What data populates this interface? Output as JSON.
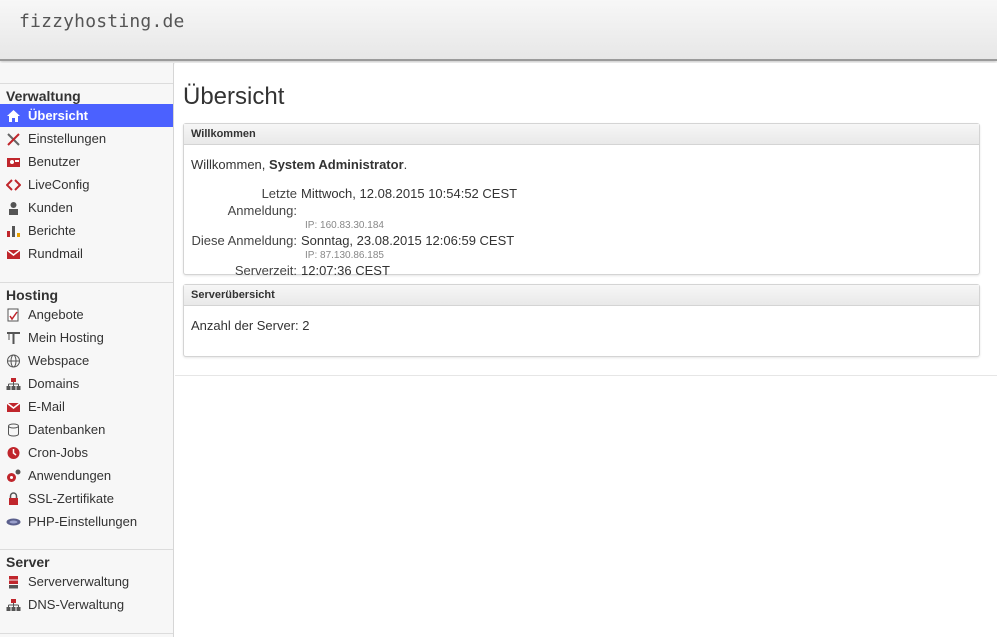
{
  "header": {
    "brand": "fizzyhosting.de"
  },
  "sidebar": {
    "sections": [
      {
        "title": "Verwaltung",
        "items": [
          {
            "label": "Übersicht",
            "icon": "home-icon",
            "active": true
          },
          {
            "label": "Einstellungen",
            "icon": "tools-icon"
          },
          {
            "label": "Benutzer",
            "icon": "users-icon"
          },
          {
            "label": "LiveConfig",
            "icon": "liveconfig-icon"
          },
          {
            "label": "Kunden",
            "icon": "customer-icon"
          },
          {
            "label": "Berichte",
            "icon": "chart-icon"
          },
          {
            "label": "Rundmail",
            "icon": "mail-icon"
          }
        ]
      },
      {
        "title": "Hosting",
        "items": [
          {
            "label": "Angebote",
            "icon": "offer-icon"
          },
          {
            "label": "Mein Hosting",
            "icon": "hosting-icon"
          },
          {
            "label": "Webspace",
            "icon": "globe-icon"
          },
          {
            "label": "Domains",
            "icon": "network-icon"
          },
          {
            "label": "E-Mail",
            "icon": "mail-icon"
          },
          {
            "label": "Datenbanken",
            "icon": "database-icon"
          },
          {
            "label": "Cron-Jobs",
            "icon": "clock-icon"
          },
          {
            "label": "Anwendungen",
            "icon": "gears-icon"
          },
          {
            "label": "SSL-Zertifikate",
            "icon": "lock-icon"
          },
          {
            "label": "PHP-Einstellungen",
            "icon": "php-icon"
          }
        ]
      },
      {
        "title": "Server",
        "items": [
          {
            "label": "Serververwaltung",
            "icon": "server-icon"
          },
          {
            "label": "DNS-Verwaltung",
            "icon": "network-icon"
          }
        ]
      }
    ]
  },
  "main": {
    "title": "Übersicht",
    "welcome_panel": {
      "header": "Willkommen",
      "greeting_prefix": "Willkommen,",
      "user_name": "System Administrator",
      "greeting_suffix": ".",
      "last_login_label": "Letzte Anmeldung:",
      "last_login_value": "Mittwoch, 12.08.2015 10:54:52 CEST",
      "last_login_ip": "IP: 160.83.30.184",
      "current_login_label": "Diese Anmeldung:",
      "current_login_value": "Sonntag, 23.08.2015 12:06:59 CEST",
      "current_login_ip": "IP: 87.130.86.185",
      "server_time_label": "Serverzeit:",
      "server_time_value": "12:07:36 CEST"
    },
    "server_panel": {
      "header": "Serverübersicht",
      "count_label": "Anzahl der Server:",
      "count_value": "2"
    }
  },
  "colors": {
    "active": "#4b61ff",
    "accent_red": "#c0262c"
  }
}
